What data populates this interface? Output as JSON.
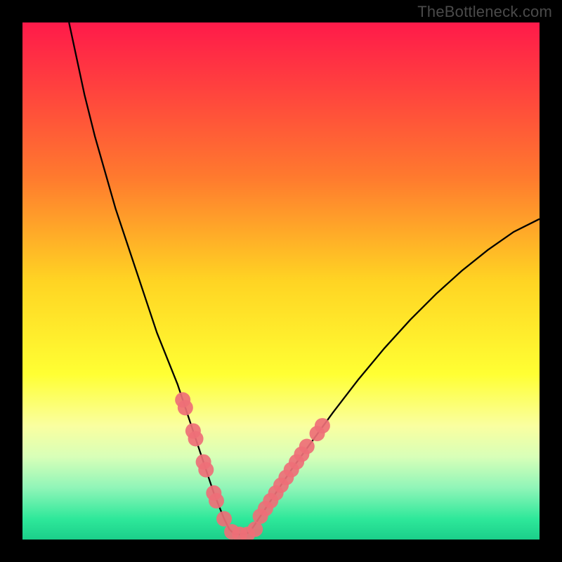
{
  "watermark": "TheBottleneck.com",
  "chart_data": {
    "type": "line",
    "title": "",
    "xlabel": "",
    "ylabel": "",
    "xlim": [
      0,
      100
    ],
    "ylim": [
      0,
      100
    ],
    "background_gradient": {
      "stops": [
        {
          "offset": 0.0,
          "color": "#ff1a4a"
        },
        {
          "offset": 0.12,
          "color": "#ff3f3f"
        },
        {
          "offset": 0.3,
          "color": "#ff7a2e"
        },
        {
          "offset": 0.5,
          "color": "#ffd423"
        },
        {
          "offset": 0.68,
          "color": "#ffff33"
        },
        {
          "offset": 0.78,
          "color": "#faffa0"
        },
        {
          "offset": 0.84,
          "color": "#d8ffb8"
        },
        {
          "offset": 0.9,
          "color": "#90f5b8"
        },
        {
          "offset": 0.96,
          "color": "#2ee89a"
        },
        {
          "offset": 1.0,
          "color": "#1bcf8a"
        }
      ]
    },
    "series": [
      {
        "name": "bottleneck-curve",
        "color": "#000000",
        "x": [
          9.0,
          10.5,
          12.0,
          14.0,
          16.0,
          18.0,
          20.0,
          22.0,
          24.0,
          26.0,
          28.0,
          30.0,
          31.0,
          32.0,
          33.0,
          34.0,
          35.0,
          36.0,
          37.0,
          38.0,
          39.0,
          40.0,
          41.0,
          42.0,
          43.0,
          44.0,
          45.0,
          47.0,
          49.0,
          52.0,
          56.0,
          60.0,
          65.0,
          70.0,
          75.0,
          80.0,
          85.0,
          90.0,
          95.0,
          100.0
        ],
        "y": [
          100.0,
          93.0,
          86.0,
          78.0,
          71.0,
          64.0,
          58.0,
          52.0,
          46.0,
          40.0,
          35.0,
          30.0,
          27.0,
          24.0,
          21.0,
          18.0,
          15.0,
          12.0,
          9.0,
          6.5,
          4.0,
          2.0,
          1.0,
          1.0,
          1.0,
          1.5,
          3.0,
          6.0,
          9.0,
          13.5,
          19.0,
          24.5,
          31.0,
          37.0,
          42.5,
          47.5,
          52.0,
          56.0,
          59.5,
          62.0
        ]
      }
    ],
    "scatter_clusters": [
      {
        "name": "left-arm-markers",
        "color": "#ee6f77",
        "radius": 11,
        "points": [
          {
            "x": 31.0,
            "y": 27.0
          },
          {
            "x": 31.5,
            "y": 25.5
          },
          {
            "x": 33.0,
            "y": 21.0
          },
          {
            "x": 33.5,
            "y": 19.5
          },
          {
            "x": 35.0,
            "y": 15.0
          },
          {
            "x": 35.5,
            "y": 13.5
          },
          {
            "x": 37.0,
            "y": 9.0
          },
          {
            "x": 37.5,
            "y": 7.5
          },
          {
            "x": 39.0,
            "y": 4.0
          }
        ]
      },
      {
        "name": "valley-markers",
        "color": "#ee6f77",
        "radius": 11,
        "points": [
          {
            "x": 40.5,
            "y": 1.5
          },
          {
            "x": 42.0,
            "y": 1.0
          },
          {
            "x": 43.5,
            "y": 1.0
          },
          {
            "x": 45.0,
            "y": 2.0
          }
        ]
      },
      {
        "name": "right-arm-markers",
        "color": "#ee6f77",
        "radius": 11,
        "points": [
          {
            "x": 46.0,
            "y": 4.5
          },
          {
            "x": 47.0,
            "y": 6.0
          },
          {
            "x": 48.0,
            "y": 7.5
          },
          {
            "x": 49.0,
            "y": 9.0
          },
          {
            "x": 50.0,
            "y": 10.5
          },
          {
            "x": 51.0,
            "y": 12.0
          },
          {
            "x": 52.0,
            "y": 13.5
          },
          {
            "x": 53.0,
            "y": 15.0
          },
          {
            "x": 54.0,
            "y": 16.5
          },
          {
            "x": 55.0,
            "y": 18.0
          },
          {
            "x": 57.0,
            "y": 20.5
          },
          {
            "x": 58.0,
            "y": 22.0
          }
        ]
      }
    ]
  }
}
